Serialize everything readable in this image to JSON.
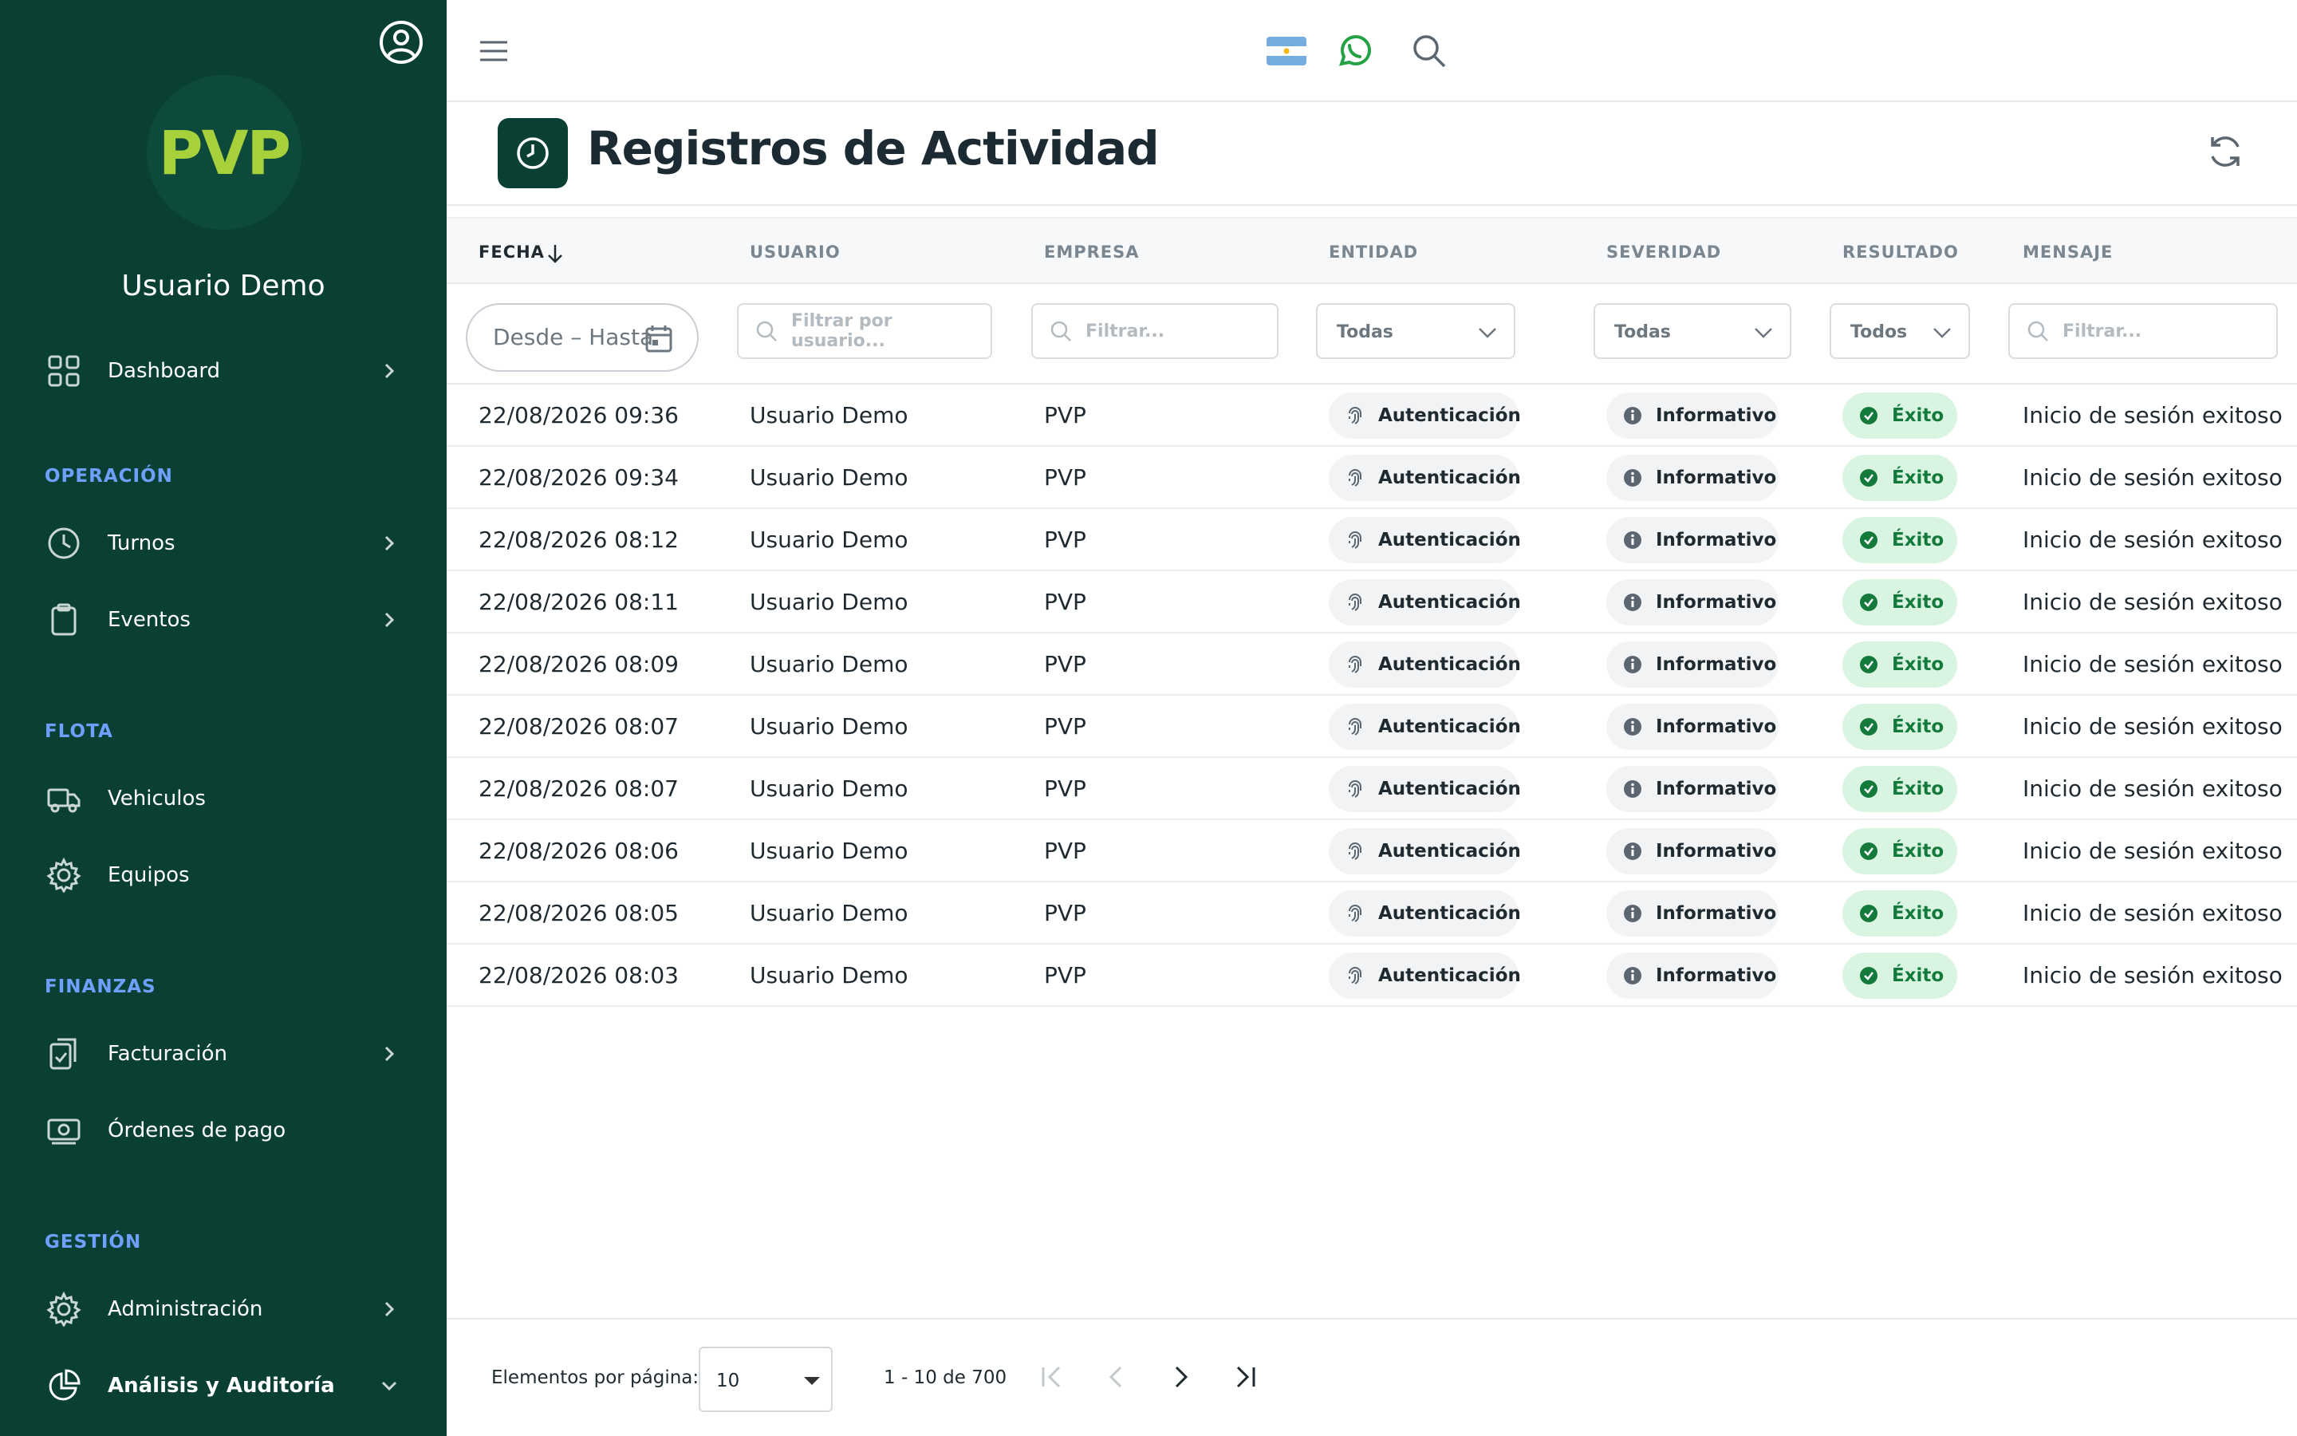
{
  "sidebar": {
    "logo_text": "PVP",
    "user_name": "Usuario Demo",
    "dashboard_label": "Dashboard",
    "sections": {
      "operacion": "OPERACIÓN",
      "flota": "FLOTA",
      "finanzas": "FINANZAS",
      "gestion": "GESTIÓN"
    },
    "items": {
      "turnos": "Turnos",
      "eventos": "Eventos",
      "vehiculos": "Vehiculos",
      "equipos": "Equipos",
      "facturacion": "Facturación",
      "ordenes": "Órdenes de pago",
      "administracion": "Administración",
      "analisis": "Análisis y Auditoría"
    }
  },
  "header": {
    "title": "Registros de Actividad"
  },
  "table": {
    "columns": {
      "fecha": "FECHA",
      "usuario": "USUARIO",
      "empresa": "EMPRESA",
      "entidad": "ENTIDAD",
      "severidad": "SEVERIDAD",
      "resultado": "RESULTADO",
      "mensaje": "MENSAJE"
    },
    "filters": {
      "date_placeholder": "Desde – Hasta",
      "usuario_placeholder": "Filtrar por usuario...",
      "empresa_placeholder": "Filtrar...",
      "entidad_value": "Todas",
      "severidad_value": "Todas",
      "resultado_value": "Todos",
      "mensaje_placeholder": "Filtrar..."
    },
    "rows": [
      {
        "fecha": "22/08/2026 09:36",
        "usuario": "Usuario Demo",
        "empresa": "PVP",
        "entidad": "Autenticación",
        "severidad": "Informativo",
        "resultado": "Éxito",
        "mensaje": "Inicio de sesión exitoso"
      },
      {
        "fecha": "22/08/2026 09:34",
        "usuario": "Usuario Demo",
        "empresa": "PVP",
        "entidad": "Autenticación",
        "severidad": "Informativo",
        "resultado": "Éxito",
        "mensaje": "Inicio de sesión exitoso"
      },
      {
        "fecha": "22/08/2026 08:12",
        "usuario": "Usuario Demo",
        "empresa": "PVP",
        "entidad": "Autenticación",
        "severidad": "Informativo",
        "resultado": "Éxito",
        "mensaje": "Inicio de sesión exitoso"
      },
      {
        "fecha": "22/08/2026 08:11",
        "usuario": "Usuario Demo",
        "empresa": "PVP",
        "entidad": "Autenticación",
        "severidad": "Informativo",
        "resultado": "Éxito",
        "mensaje": "Inicio de sesión exitoso"
      },
      {
        "fecha": "22/08/2026 08:09",
        "usuario": "Usuario Demo",
        "empresa": "PVP",
        "entidad": "Autenticación",
        "severidad": "Informativo",
        "resultado": "Éxito",
        "mensaje": "Inicio de sesión exitoso"
      },
      {
        "fecha": "22/08/2026 08:07",
        "usuario": "Usuario Demo",
        "empresa": "PVP",
        "entidad": "Autenticación",
        "severidad": "Informativo",
        "resultado": "Éxito",
        "mensaje": "Inicio de sesión exitoso"
      },
      {
        "fecha": "22/08/2026 08:07",
        "usuario": "Usuario Demo",
        "empresa": "PVP",
        "entidad": "Autenticación",
        "severidad": "Informativo",
        "resultado": "Éxito",
        "mensaje": "Inicio de sesión exitoso"
      },
      {
        "fecha": "22/08/2026 08:06",
        "usuario": "Usuario Demo",
        "empresa": "PVP",
        "entidad": "Autenticación",
        "severidad": "Informativo",
        "resultado": "Éxito",
        "mensaje": "Inicio de sesión exitoso"
      },
      {
        "fecha": "22/08/2026 08:05",
        "usuario": "Usuario Demo",
        "empresa": "PVP",
        "entidad": "Autenticación",
        "severidad": "Informativo",
        "resultado": "Éxito",
        "mensaje": "Inicio de sesión exitoso"
      },
      {
        "fecha": "22/08/2026 08:03",
        "usuario": "Usuario Demo",
        "empresa": "PVP",
        "entidad": "Autenticación",
        "severidad": "Informativo",
        "resultado": "Éxito",
        "mensaje": "Inicio de sesión exitoso"
      }
    ]
  },
  "pagination": {
    "per_page_label": "Elementos por página:",
    "per_page_value": "10",
    "range_label": "1 - 10 de 700"
  },
  "icons": {
    "profile": "user-circle-icon",
    "menu": "hamburger-menu-icon",
    "flag": "argentina-flag-icon",
    "whatsapp": "whatsapp-icon",
    "search": "search-icon",
    "refresh": "refresh-icon",
    "title": "clock-icon"
  },
  "colors": {
    "sidebar_bg": "#0a4034",
    "logo": "#a6d13a",
    "section_title": "#6fa0ff",
    "success_bg": "#d9f5e1",
    "success_text": "#137a3c"
  }
}
